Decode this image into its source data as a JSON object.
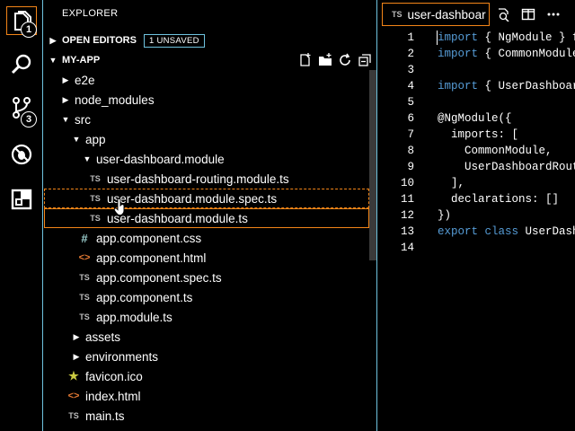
{
  "activity_bar": {
    "items": [
      {
        "icon": "files-icon",
        "badge": "1"
      },
      {
        "icon": "search-icon",
        "badge": ""
      },
      {
        "icon": "source-control-icon",
        "badge": "3"
      },
      {
        "icon": "debug-icon",
        "badge": ""
      },
      {
        "icon": "extensions-icon",
        "badge": ""
      }
    ]
  },
  "sidebar": {
    "title": "EXPLORER",
    "open_editors": {
      "label": "OPEN EDITORS",
      "badge": "1 UNSAVED"
    },
    "project": {
      "label": "MY-APP"
    },
    "tree": [
      {
        "label": "e2e",
        "twisty": "▶",
        "icon": ""
      },
      {
        "label": "node_modules",
        "twisty": "▶",
        "icon": ""
      },
      {
        "label": "src",
        "twisty": "▼",
        "icon": ""
      },
      {
        "label": "app",
        "twisty": "▼",
        "icon": ""
      },
      {
        "label": "user-dashboard.module",
        "twisty": "▼",
        "icon": ""
      },
      {
        "label": "user-dashboard-routing.module.ts",
        "twisty": "",
        "icon": "TS"
      },
      {
        "label": "user-dashboard.module.spec.ts",
        "twisty": "",
        "icon": "TS"
      },
      {
        "label": "user-dashboard.module.ts",
        "twisty": "",
        "icon": "TS"
      },
      {
        "label": "app.component.css",
        "twisty": "",
        "icon": "#"
      },
      {
        "label": "app.component.html",
        "twisty": "",
        "icon": "<>"
      },
      {
        "label": "app.component.spec.ts",
        "twisty": "",
        "icon": "TS"
      },
      {
        "label": "app.component.ts",
        "twisty": "",
        "icon": "TS"
      },
      {
        "label": "app.module.ts",
        "twisty": "",
        "icon": "TS"
      },
      {
        "label": "assets",
        "twisty": "▶",
        "icon": ""
      },
      {
        "label": "environments",
        "twisty": "▶",
        "icon": ""
      },
      {
        "label": "favicon.ico",
        "twisty": "",
        "icon": "★"
      },
      {
        "label": "index.html",
        "twisty": "",
        "icon": "<>"
      },
      {
        "label": "main.ts",
        "twisty": "",
        "icon": "TS"
      }
    ]
  },
  "editor": {
    "tab": {
      "icon": "TS",
      "label": "user-dashboar"
    },
    "lines": [
      {
        "n": "1",
        "pre": "",
        "kw": "import",
        "post": " { NgModule } f"
      },
      {
        "n": "2",
        "pre": "",
        "kw": "import",
        "post": " { CommonModule"
      },
      {
        "n": "3",
        "pre": "",
        "kw": "",
        "post": ""
      },
      {
        "n": "4",
        "pre": "",
        "kw": "import",
        "post": " { UserDashboard"
      },
      {
        "n": "5",
        "pre": "",
        "kw": "",
        "post": ""
      },
      {
        "n": "6",
        "pre": "",
        "kw": "",
        "post": "@NgModule({"
      },
      {
        "n": "7",
        "pre": "",
        "kw": "",
        "post": "  imports: ["
      },
      {
        "n": "8",
        "pre": "",
        "kw": "",
        "post": "    CommonModule,"
      },
      {
        "n": "9",
        "pre": "",
        "kw": "",
        "post": "    UserDashboardRout"
      },
      {
        "n": "10",
        "pre": "",
        "kw": "",
        "post": "  ],"
      },
      {
        "n": "11",
        "pre": "",
        "kw": "",
        "post": "  declarations: []"
      },
      {
        "n": "12",
        "pre": "",
        "kw": "",
        "post": "})"
      },
      {
        "n": "13",
        "pre": "",
        "kw": "export class",
        "post": " UserDash"
      },
      {
        "n": "14",
        "pre": "",
        "kw": "",
        "post": ""
      }
    ]
  },
  "colors": {
    "accent": "#f38518",
    "border": "#6fc3df",
    "keyword": "#569cd6"
  }
}
